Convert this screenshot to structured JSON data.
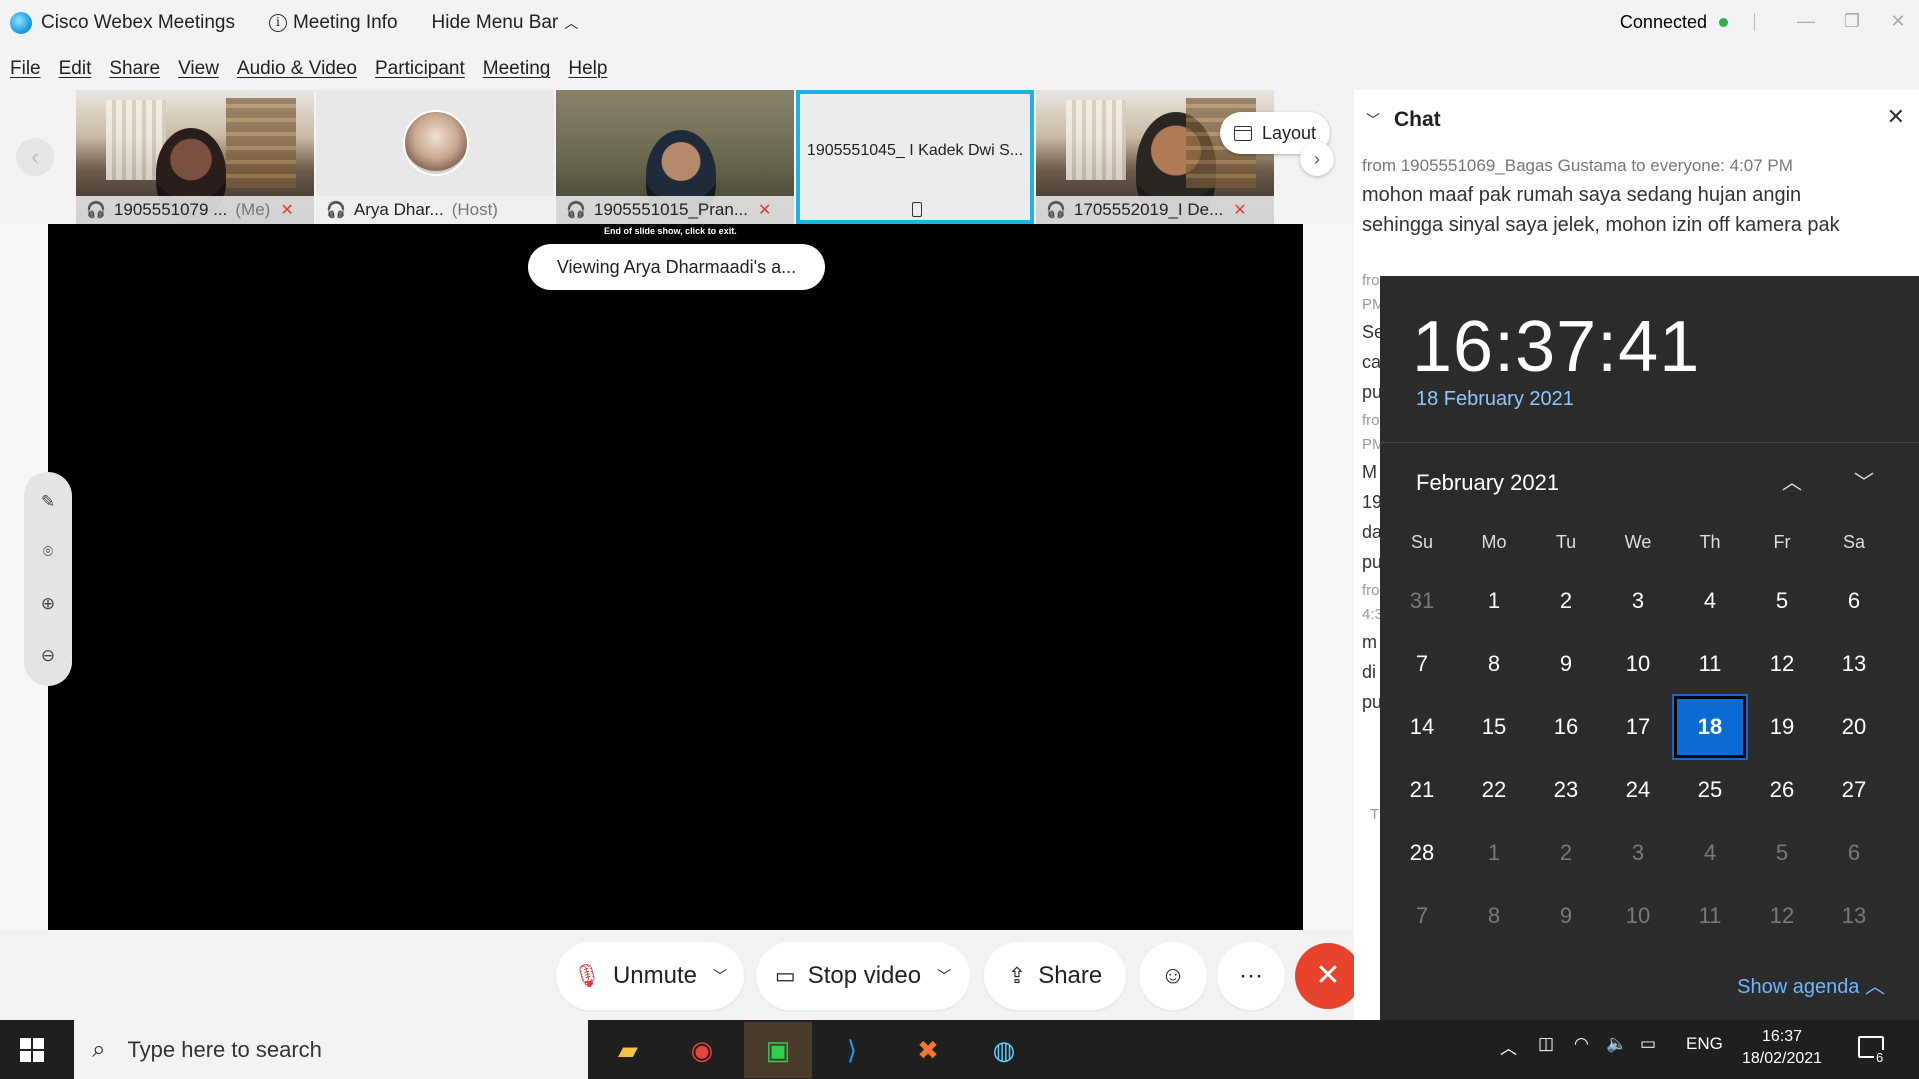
{
  "titlebar": {
    "app_name": "Cisco Webex Meetings",
    "meeting_info": "Meeting Info",
    "hide_menu_bar": "Hide Menu Bar",
    "status": "Connected"
  },
  "menu": [
    "File",
    "Edit",
    "Share",
    "View",
    "Audio & Video",
    "Participant",
    "Meeting",
    "Help"
  ],
  "participants": [
    {
      "name": "1905551079 ...",
      "suffix": "(Me)",
      "muted": true
    },
    {
      "name": "Arya Dhar...",
      "suffix": "(Host)",
      "muted": false
    },
    {
      "name": "1905551015_Pran...",
      "suffix": "",
      "muted": true
    },
    {
      "name": "1905551045_ I Kadek Dwi S...",
      "suffix": "",
      "muted": false
    },
    {
      "name": "1705552019_I De...",
      "suffix": "",
      "muted": true
    }
  ],
  "layout_label": "Layout",
  "stage": {
    "end_slide_text": "End of slide show, click to exit.",
    "viewing_text": "Viewing Arya Dharmaadi's a..."
  },
  "controls": {
    "unmute": "Unmute",
    "stop_video": "Stop video",
    "share": "Share"
  },
  "chat": {
    "title": "Chat",
    "message": {
      "meta": "from 1905551069_Bagas Gustama to everyone:    4:07 PM",
      "text": "mohon maaf pak rumah saya sedang hujan angin sehingga sinyal saya jelek, mohon izin off kamera pak"
    },
    "fragments": [
      "fro",
      "PM",
      "Se",
      "ca",
      "pu",
      "fro",
      "PM",
      "M",
      "19",
      "da",
      "pu",
      "fro",
      "4:3",
      "m",
      "di",
      "pu",
      "T"
    ]
  },
  "calendar": {
    "time": "16:37:41",
    "date": "18 February 2021",
    "month_label": "February 2021",
    "weekdays": [
      "Su",
      "Mo",
      "Tu",
      "We",
      "Th",
      "Fr",
      "Sa"
    ],
    "weeks": [
      [
        [
          "31",
          1
        ],
        [
          "1",
          0
        ],
        [
          "2",
          0
        ],
        [
          "3",
          0
        ],
        [
          "4",
          0
        ],
        [
          "5",
          0
        ],
        [
          "6",
          0
        ]
      ],
      [
        [
          "7",
          0
        ],
        [
          "8",
          0
        ],
        [
          "9",
          0
        ],
        [
          "10",
          0
        ],
        [
          "11",
          0
        ],
        [
          "12",
          0
        ],
        [
          "13",
          0
        ]
      ],
      [
        [
          "14",
          0
        ],
        [
          "15",
          0
        ],
        [
          "16",
          0
        ],
        [
          "17",
          0
        ],
        [
          "18",
          2
        ],
        [
          "19",
          0
        ],
        [
          "20",
          0
        ]
      ],
      [
        [
          "21",
          0
        ],
        [
          "22",
          0
        ],
        [
          "23",
          0
        ],
        [
          "24",
          0
        ],
        [
          "25",
          0
        ],
        [
          "26",
          0
        ],
        [
          "27",
          0
        ]
      ],
      [
        [
          "28",
          0
        ],
        [
          "1",
          1
        ],
        [
          "2",
          1
        ],
        [
          "3",
          1
        ],
        [
          "4",
          1
        ],
        [
          "5",
          1
        ],
        [
          "6",
          1
        ]
      ],
      [
        [
          "7",
          1
        ],
        [
          "8",
          1
        ],
        [
          "9",
          1
        ],
        [
          "10",
          1
        ],
        [
          "11",
          1
        ],
        [
          "12",
          1
        ],
        [
          "13",
          1
        ]
      ]
    ],
    "show_agenda": "Show agenda"
  },
  "taskbar": {
    "search_placeholder": "Type here to search",
    "language": "ENG",
    "clock_time": "16:37",
    "clock_date": "18/02/2021",
    "notification_count": "6"
  }
}
